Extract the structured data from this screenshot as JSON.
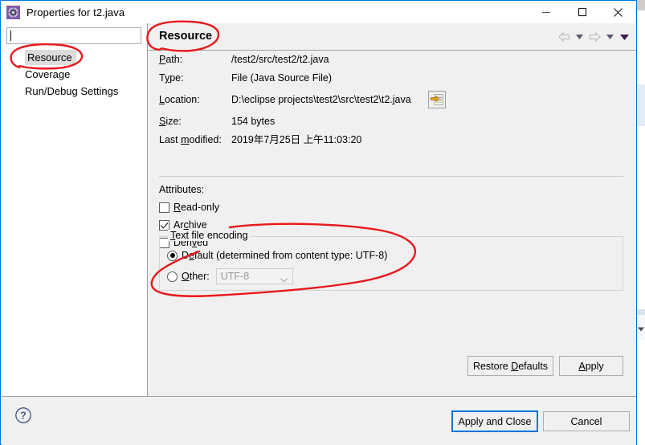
{
  "window": {
    "title": "Properties for t2.java",
    "icon": "properties-gear-icon",
    "accent_color": "#0078d7",
    "controls": {
      "minimize": "minimize-icon",
      "maximize": "maximize-icon",
      "close": "close-icon"
    }
  },
  "sidebar": {
    "filter": {
      "value": "",
      "placeholder": ""
    },
    "items": [
      {
        "label": "Resource",
        "selected": true
      },
      {
        "label": "Coverage",
        "selected": false
      },
      {
        "label": "Run/Debug Settings",
        "selected": false
      }
    ]
  },
  "content": {
    "title": "Resource",
    "nav": {
      "back": "back-arrow-icon",
      "back_dropdown": "chevron-down-icon",
      "forward": "forward-arrow-icon",
      "forward_dropdown": "chevron-down-icon",
      "menu": "view-menu-icon"
    },
    "properties": [
      {
        "label": "Path:",
        "value": "/test2/src/test2/t2.java"
      },
      {
        "label": "Type:",
        "value": "File  (Java Source File)"
      },
      {
        "label": "Location:",
        "value": "D:\\eclipse projects\\test2\\src\\test2\\t2.java"
      },
      {
        "label": "Size:",
        "value": "154  bytes"
      },
      {
        "label": "Last modified:",
        "value": "2019年7月25日 上午11:03:20"
      }
    ],
    "location_button_icon": "open-folder-icon",
    "attributes": {
      "title": "Attributes:",
      "items": [
        {
          "label": "Read-only",
          "checked": false
        },
        {
          "label": "Archive",
          "checked": true
        },
        {
          "label": "Derived",
          "checked": false
        }
      ]
    },
    "encoding": {
      "legend": "Text file encoding",
      "default_option": "Default (determined from content type: UTF-8)",
      "default_selected": true,
      "other_option": "Other:",
      "other_selected": false,
      "other_value": "UTF-8",
      "other_enabled": false
    },
    "buttons": {
      "restore_defaults": "Restore Defaults",
      "apply": "Apply"
    }
  },
  "footer": {
    "help_icon": "help-question-icon",
    "apply_and_close": "Apply and Close",
    "cancel": "Cancel",
    "focused_button": "Apply and Close"
  },
  "annotations": {
    "color": "#e8181b",
    "marks": [
      {
        "name": "circle-content-title",
        "target": "Resource heading"
      },
      {
        "name": "circle-sidebar-resource",
        "target": "Resource tree item"
      },
      {
        "name": "circle-text-file-encoding",
        "target": "Text file encoding group"
      }
    ]
  },
  "scrollbar": {
    "name": "page-scrollbar",
    "down_arrow": "chevron-down-icon"
  }
}
